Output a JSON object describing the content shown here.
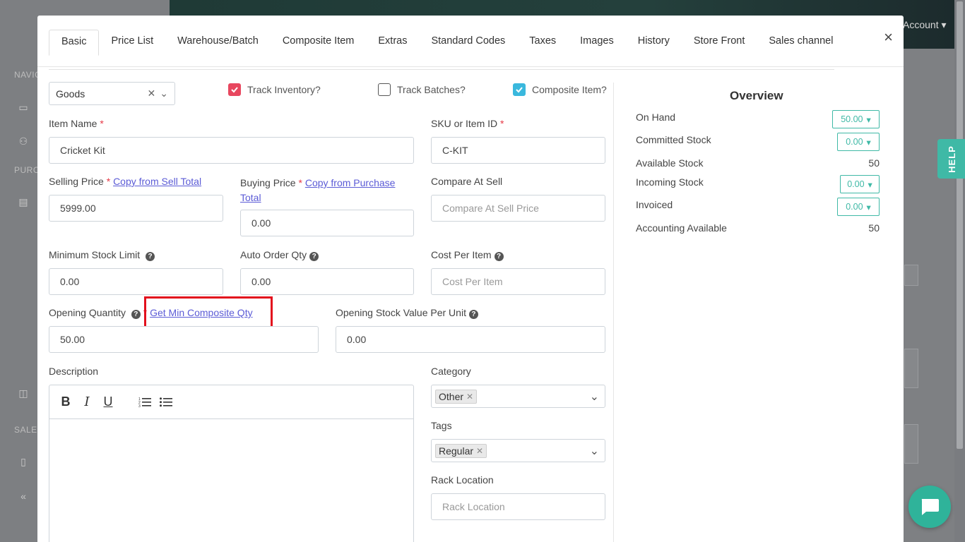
{
  "background": {
    "account_label": "Account",
    "nav_labels": [
      "NAVIG",
      "PURC",
      "SALES"
    ],
    "help_label": "HELP"
  },
  "tabs": [
    "Basic",
    "Price List",
    "Warehouse/Batch",
    "Composite Item",
    "Extras",
    "Standard Codes",
    "Taxes",
    "Images",
    "History",
    "Store Front",
    "Sales channel"
  ],
  "active_tab": "Basic",
  "close_label": "×",
  "form": {
    "type_select": "Goods",
    "track_inventory": {
      "label": "Track Inventory?",
      "checked": true
    },
    "track_batches": {
      "label": "Track Batches?",
      "checked": false
    },
    "composite_item": {
      "label": "Composite Item?",
      "checked": true
    },
    "item_name": {
      "label": "Item Name",
      "value": "Cricket Kit"
    },
    "sku": {
      "label": "SKU or Item ID",
      "value": "C-KIT"
    },
    "selling_price": {
      "label": "Selling Price",
      "link": "Copy from Sell Total",
      "value": "5999.00"
    },
    "buying_price": {
      "label": "Buying Price",
      "link1": "Copy from Purchase",
      "link2": "Total",
      "value": "0.00"
    },
    "compare_at_sell": {
      "label": "Compare At Sell",
      "placeholder": "Compare At Sell Price"
    },
    "min_stock": {
      "label": "Minimum Stock Limit",
      "value": "0.00"
    },
    "auto_order": {
      "label": "Auto Order Qty",
      "value": "0.00"
    },
    "cost_per_item": {
      "label": "Cost Per Item",
      "placeholder": "Cost Per Item"
    },
    "opening_qty": {
      "label": "Opening Quantity",
      "link": "Get Min Composite Qty",
      "value": "50.00"
    },
    "opening_value": {
      "label": "Opening Stock Value Per Unit",
      "value": "0.00"
    },
    "description": {
      "label": "Description"
    },
    "category": {
      "label": "Category",
      "tag": "Other"
    },
    "tags": {
      "label": "Tags",
      "tag": "Regular"
    },
    "rack_location": {
      "label": "Rack Location",
      "placeholder": "Rack Location"
    }
  },
  "overview": {
    "title": "Overview",
    "on_hand": {
      "label": "On Hand",
      "value": "50.00"
    },
    "committed": {
      "label": "Committed Stock",
      "value": "0.00"
    },
    "available": {
      "label": "Available Stock",
      "value": "50"
    },
    "incoming": {
      "label": "Incoming Stock",
      "value": "0.00"
    },
    "invoiced": {
      "label": "Invoiced",
      "value": "0.00"
    },
    "accounting": {
      "label": "Accounting Available",
      "value": "50"
    }
  },
  "colors": {
    "accent": "#3fb9a6",
    "link": "#5b5bd6",
    "required": "#e63946",
    "checkbox_red": "#e8475f",
    "checkbox_blue": "#3ab8dd",
    "highlight": "#e3101d"
  }
}
